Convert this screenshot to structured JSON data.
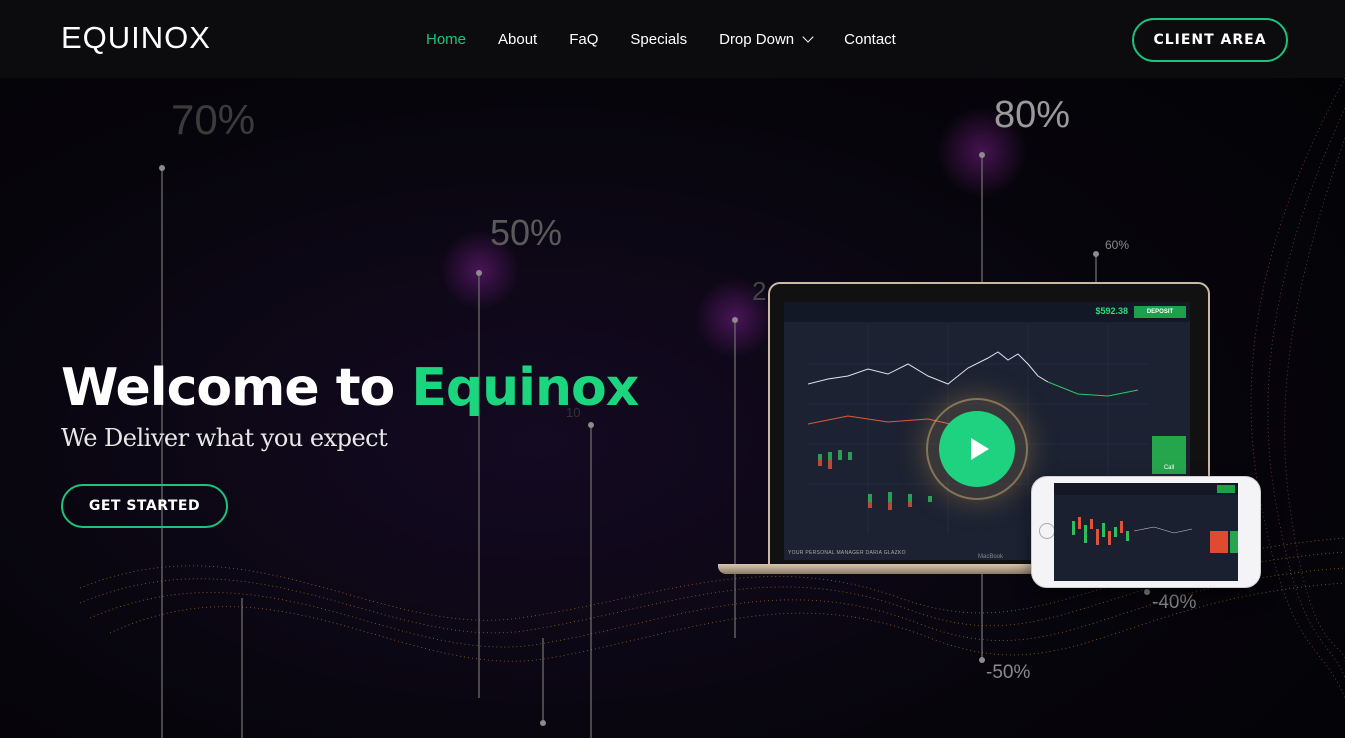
{
  "header": {
    "logo": "EQUINOX",
    "nav": [
      {
        "label": "Home",
        "active": true
      },
      {
        "label": "About"
      },
      {
        "label": "FaQ"
      },
      {
        "label": "Specials"
      },
      {
        "label": "Drop Down",
        "has_dropdown": true
      },
      {
        "label": "Contact"
      }
    ],
    "client_area": "CLIENT AREA"
  },
  "hero": {
    "title_prefix": "Welcome to ",
    "title_accent": "Equinox",
    "subtitle": "We Deliver what you expect",
    "cta": "GET STARTED"
  },
  "background_percents": {
    "p70": "70%",
    "p50": "50%",
    "p80": "80%",
    "p60": "60%",
    "pn40": "-40%",
    "pn50": "-50%",
    "p2": "2",
    "p10": "10"
  },
  "trading_screen": {
    "balance": "$592.38",
    "deposit": "DEPOSIT",
    "call": "Call",
    "brand": "MacBook",
    "manager": "YOUR PERSONAL MANAGER DARIA GLAZKO"
  },
  "colors": {
    "accent": "#1bd67f",
    "header_bg": "#0c0c0e",
    "call": "#26a64c",
    "put": "#e04a31"
  },
  "icons": [
    "chevron-down-icon",
    "play-icon"
  ]
}
